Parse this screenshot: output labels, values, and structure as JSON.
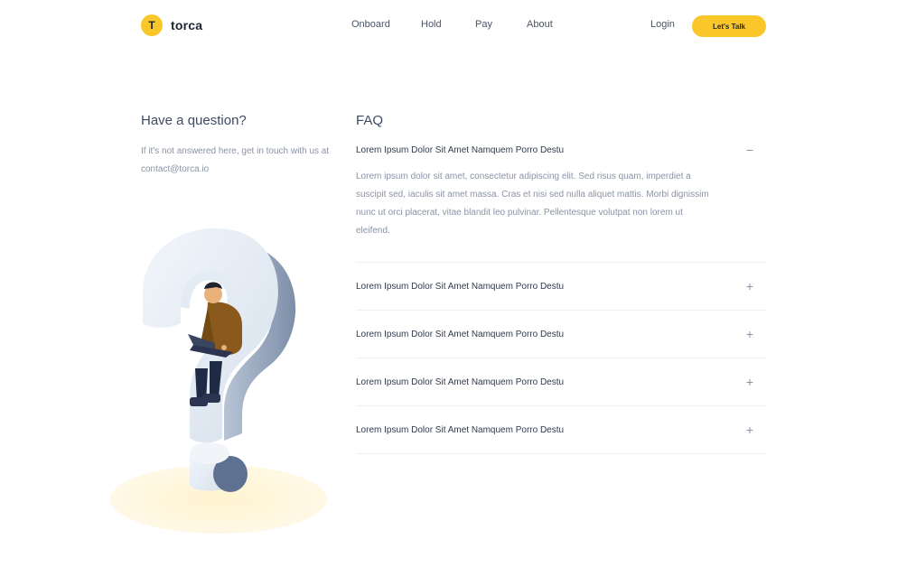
{
  "brand": {
    "logo_letter": "T",
    "name": "torca",
    "accent_color": "#f9c72a"
  },
  "nav": {
    "items": [
      {
        "label": "Onboard"
      },
      {
        "label": "Hold"
      },
      {
        "label": "Pay"
      },
      {
        "label": "About"
      }
    ],
    "login_label": "Login",
    "cta_label": "Let's Talk"
  },
  "intro": {
    "title": "Have a question?",
    "subtitle": "If it's not answered here, get in touch with us at contact@torca.io"
  },
  "faq": {
    "title": "FAQ",
    "items": [
      {
        "question": "Lorem Ipsum Dolor Sit Amet Namquem Porro Destu",
        "expanded": true,
        "toggle": "−",
        "answer": "Lorem ipsum dolor sit amet, consectetur adipiscing elit. Sed risus quam, imperdiet a suscipit sed, iaculis sit amet massa. Cras et nisi sed nulla aliquet mattis. Morbi dignissim nunc ut orci placerat, vitae blandit leo pulvinar. Pellentesque volutpat non lorem ut eleifend."
      },
      {
        "question": "Lorem Ipsum Dolor Sit Amet Namquem Porro Destu",
        "expanded": false,
        "toggle": "+"
      },
      {
        "question": "Lorem Ipsum Dolor Sit Amet Namquem Porro Destu",
        "expanded": false,
        "toggle": "+"
      },
      {
        "question": "Lorem Ipsum Dolor Sit Amet Namquem Porro Destu",
        "expanded": false,
        "toggle": "+"
      },
      {
        "question": "Lorem Ipsum Dolor Sit Amet Namquem Porro Destu",
        "expanded": false,
        "toggle": "+"
      }
    ]
  },
  "illustration": {
    "icon": "question-mark-person-illustration"
  }
}
